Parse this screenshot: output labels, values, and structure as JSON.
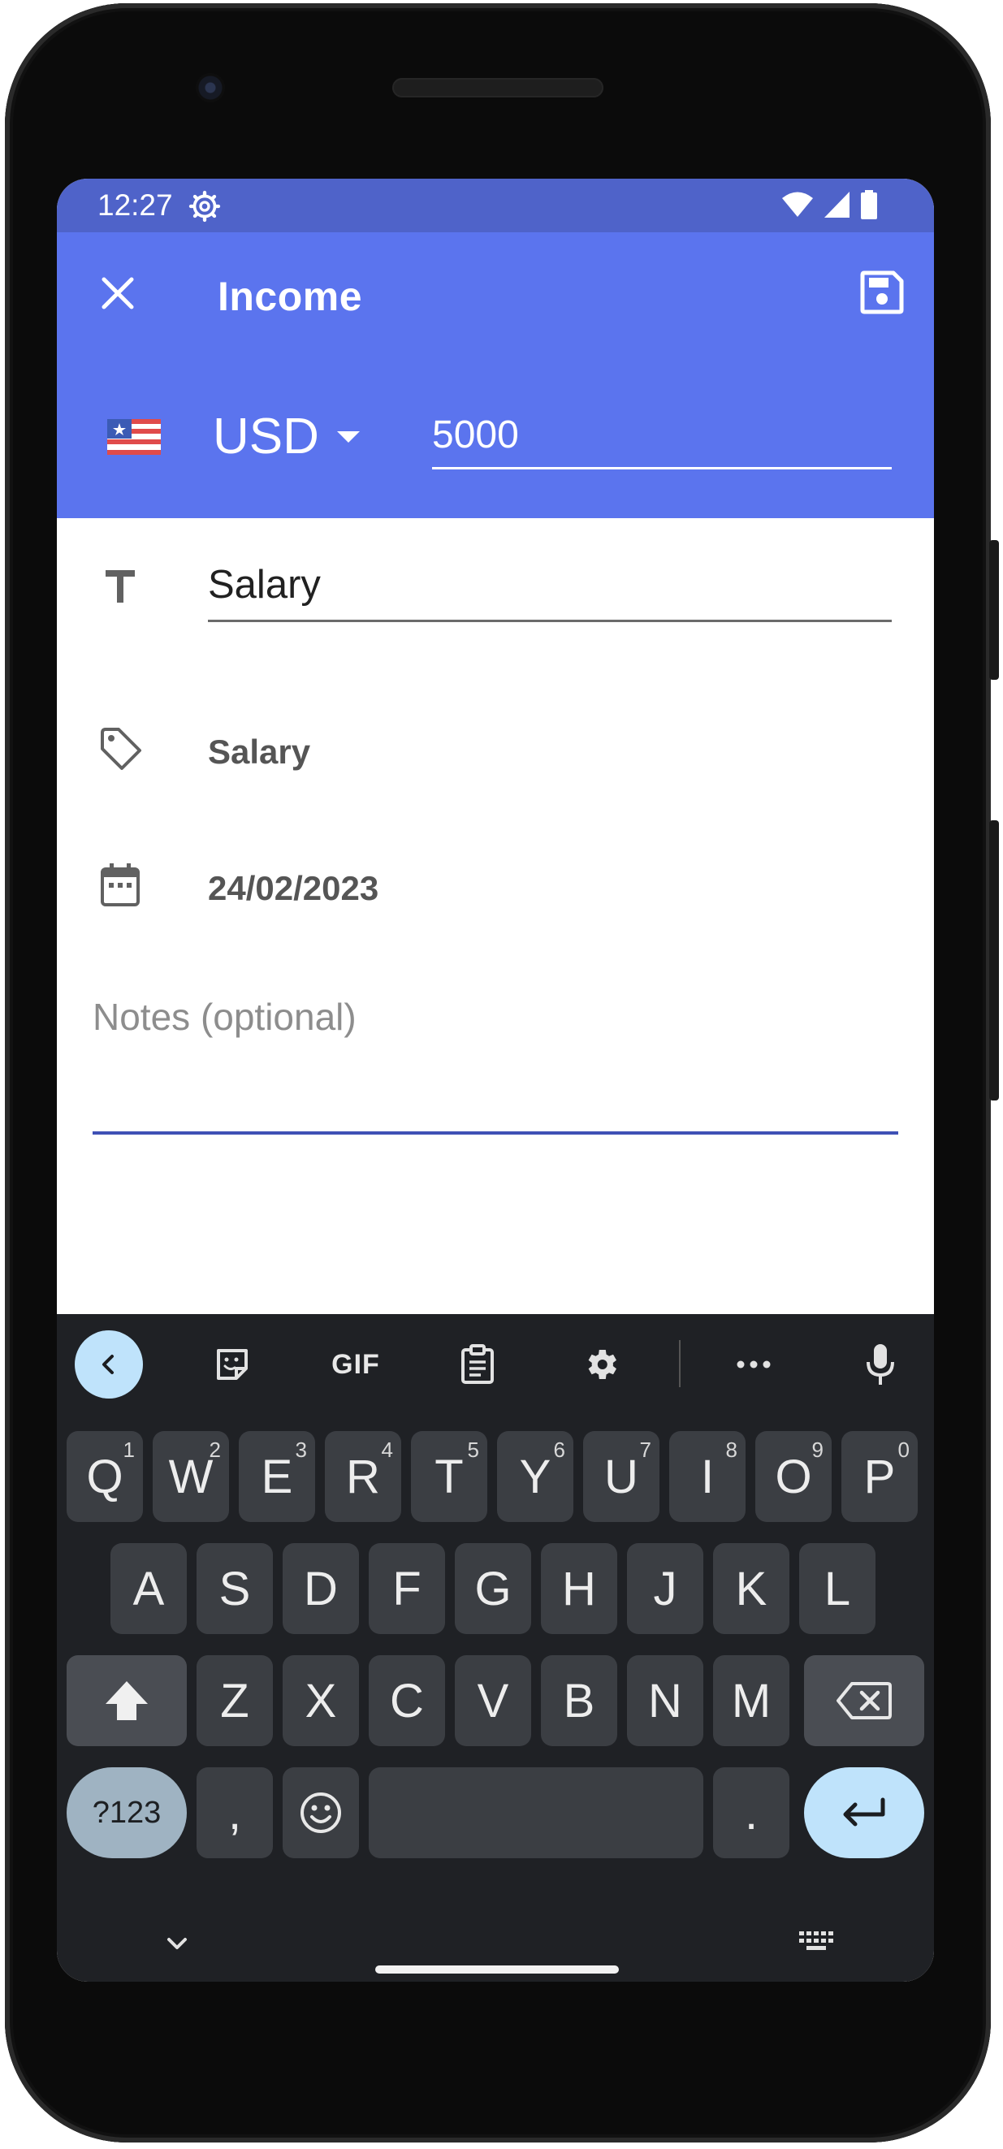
{
  "status_bar": {
    "time": "12:27",
    "icons": [
      "settings-gear-icon",
      "wifi-icon",
      "cellular-signal-icon",
      "battery-icon"
    ]
  },
  "app_bar": {
    "title": "Income",
    "close_icon": "close-icon",
    "save_icon": "save-floppy-icon"
  },
  "amount": {
    "currency": "USD",
    "flag_icon": "us-flag-icon",
    "value": "5000"
  },
  "form": {
    "title_value": "Salary",
    "category": "Salary",
    "date": "24/02/2023",
    "notes_placeholder": "Notes (optional)"
  },
  "keyboard": {
    "toolbar": {
      "gif_label": "GIF",
      "icons": [
        "back-chevron-icon",
        "sticker-icon",
        "clipboard-icon",
        "settings-gear-icon",
        "more-dots-icon",
        "microphone-icon"
      ]
    },
    "row1": [
      {
        "label": "Q",
        "hint": "1"
      },
      {
        "label": "W",
        "hint": "2"
      },
      {
        "label": "E",
        "hint": "3"
      },
      {
        "label": "R",
        "hint": "4"
      },
      {
        "label": "T",
        "hint": "5"
      },
      {
        "label": "Y",
        "hint": "6"
      },
      {
        "label": "U",
        "hint": "7"
      },
      {
        "label": "I",
        "hint": "8"
      },
      {
        "label": "O",
        "hint": "9"
      },
      {
        "label": "P",
        "hint": "0"
      }
    ],
    "row2": [
      "A",
      "S",
      "D",
      "F",
      "G",
      "H",
      "J",
      "K",
      "L"
    ],
    "row3": [
      "Z",
      "X",
      "C",
      "V",
      "B",
      "N",
      "M"
    ],
    "row4": {
      "symbols": "?123",
      "comma": ",",
      "period": "."
    }
  },
  "colors": {
    "status_bar": "#4f63c9",
    "app_bar": "#5b74ee",
    "notes_underline": "#3f51b5",
    "keyboard_bg": "#1f2125",
    "key_bg": "#3b3e43",
    "accent_key": "#bfe3fb"
  }
}
